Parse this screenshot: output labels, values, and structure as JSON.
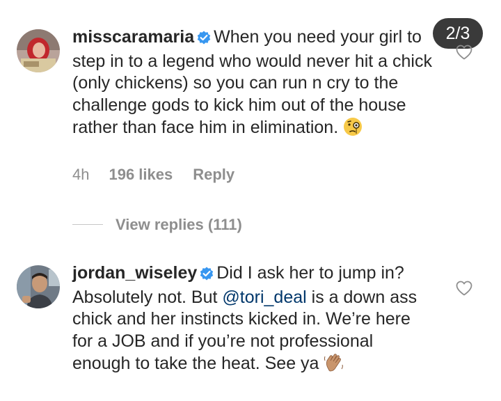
{
  "indicator": {
    "text": "2/3"
  },
  "comments": [
    {
      "username": "misscaramaria",
      "text": "When you need your girl to step in to a legend who would never hit a chick (only chickens) so you can run n cry to the challenge gods to kick him out of the house rather than face him in elimination.",
      "emoji": "face-with-monocle",
      "time": "4h",
      "likes": "196 likes",
      "reply_label": "Reply",
      "view_replies": "View replies (111)",
      "verified": true
    },
    {
      "username": "jordan_wiseley",
      "text_before_mention": "Did I ask her to jump in? Absolutely not. But ",
      "mention": "@tori_deal",
      "text_after_mention": " is a down ass chick and her instincts kicked in. We’re here for a JOB and if you’re not professional enough to take the heat. See ya",
      "emoji": "waving-hand",
      "verified": true
    }
  ],
  "colors": {
    "text": "#262626",
    "secondary": "#8e8e8e",
    "verified": "#3897f0",
    "mention": "#00376b",
    "indicator_bg": "#3a3a3a"
  }
}
